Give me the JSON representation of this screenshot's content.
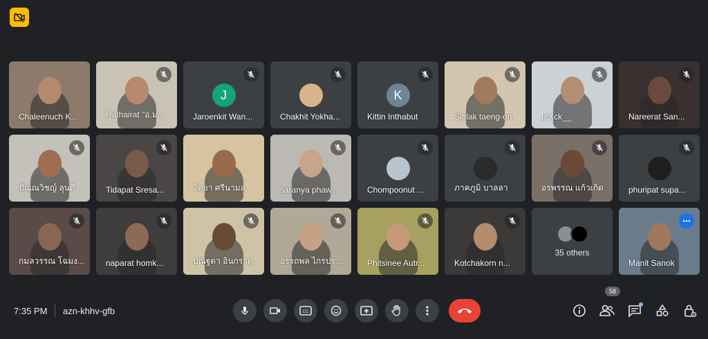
{
  "app": {
    "warning_icon": "camera-off-icon",
    "accent": "#8ab4f8",
    "end_call_color": "#ea4335"
  },
  "tiles": [
    {
      "name": "Chaleenuch K...",
      "type": "video",
      "bg": "#8c7a6a",
      "skin": "#b48a6e",
      "muted": false
    },
    {
      "name": "Hathairat \"อ.ม...",
      "type": "video",
      "bg": "#c9c3b6",
      "skin": "#b8896c",
      "muted": true
    },
    {
      "name": "Jaroenkit Wan...",
      "type": "avatar",
      "letter": "J",
      "avatar_color": "#12a37f",
      "muted": true
    },
    {
      "name": "Chakhit Yokha...",
      "type": "avatar",
      "letter": "",
      "avatar_color": "#d9b38c",
      "muted": true
    },
    {
      "name": "Kittin Inthabut",
      "type": "avatar",
      "letter": "K",
      "avatar_color": "#6e8596",
      "muted": true
    },
    {
      "name": "Sirilak taeng-on",
      "type": "video",
      "bg": "#d2c6b0",
      "skin": "#a27a5c",
      "muted": true
    },
    {
      "name": "ptXck__",
      "type": "video",
      "bg": "#cdd1d4",
      "skin": "#b48d72",
      "muted": true
    },
    {
      "name": "Nareerat San...",
      "type": "video",
      "bg": "#3a3030",
      "skin": "#6a4a3c",
      "muted": true
    },
    {
      "name": "ปัณณวิชญ์ ลุนดี",
      "type": "video",
      "bg": "#c4c0ba",
      "skin": "#9d6e52",
      "muted": true
    },
    {
      "name": "Tidapat Sresa...",
      "type": "video",
      "bg": "#4a4646",
      "skin": "#7a5a48",
      "muted": true
    },
    {
      "name": "วิทยา ศรีนามล",
      "type": "video",
      "bg": "#d6c3a2",
      "skin": "#9a6a48",
      "muted": false
    },
    {
      "name": "saranya phaw...",
      "type": "video",
      "bg": "#bcb8b4",
      "skin": "#c8a48a",
      "muted": true
    },
    {
      "name": "Chompoonut ...",
      "type": "avatar",
      "letter": "",
      "avatar_color": "#b9c4cc",
      "muted": true
    },
    {
      "name": "ภาคภูมิ บาลลา",
      "type": "avatar",
      "letter": "",
      "avatar_color": "#2b2b2b",
      "muted": true
    },
    {
      "name": "อรพรรณ แก้วเกิด",
      "type": "video",
      "bg": "#7a7068",
      "skin": "#6a4a36",
      "muted": true
    },
    {
      "name": "phuripat supa...",
      "type": "avatar",
      "letter": "",
      "avatar_color": "#1e1e1e",
      "muted": true
    },
    {
      "name": "กมลวรรณ โฉมง...",
      "type": "video",
      "bg": "#5a4a48",
      "skin": "#8a6652",
      "muted": true
    },
    {
      "name": "naparat homk...",
      "type": "video",
      "bg": "#3f3c3c",
      "skin": "#8c6a56",
      "muted": true
    },
    {
      "name": "ปณิฐดา อินกราต",
      "type": "video",
      "bg": "#cfc3a6",
      "skin": "#6a4a36",
      "muted": true
    },
    {
      "name": "อรรถพล ไกรประ...",
      "type": "video",
      "bg": "#b2a898",
      "skin": "#c8a084",
      "muted": true
    },
    {
      "name": "Phitsinee Autr...",
      "type": "video",
      "bg": "#a8a060",
      "skin": "#c49a7a",
      "muted": true
    },
    {
      "name": "Kotchakorn n...",
      "type": "video",
      "bg": "#3c3a38",
      "skin": "#b48c6e",
      "muted": true
    },
    {
      "name": "35 others",
      "type": "others"
    },
    {
      "name": "Manit Sanok",
      "type": "video",
      "bg": "#6a7c8c",
      "skin": "#a0785c",
      "muted": false,
      "selected": true
    }
  ],
  "bottom": {
    "time": "7:35 PM",
    "meeting_code": "azn-khhv-gfb",
    "participants_count": "58",
    "controls": [
      "microphone-icon",
      "camera-icon",
      "captions-icon",
      "emoji-icon",
      "present-icon",
      "raise-hand-icon",
      "more-options-icon",
      "end-call-icon"
    ],
    "right": [
      "info-icon",
      "people-icon",
      "chat-icon",
      "activities-icon",
      "host-controls-icon"
    ]
  }
}
